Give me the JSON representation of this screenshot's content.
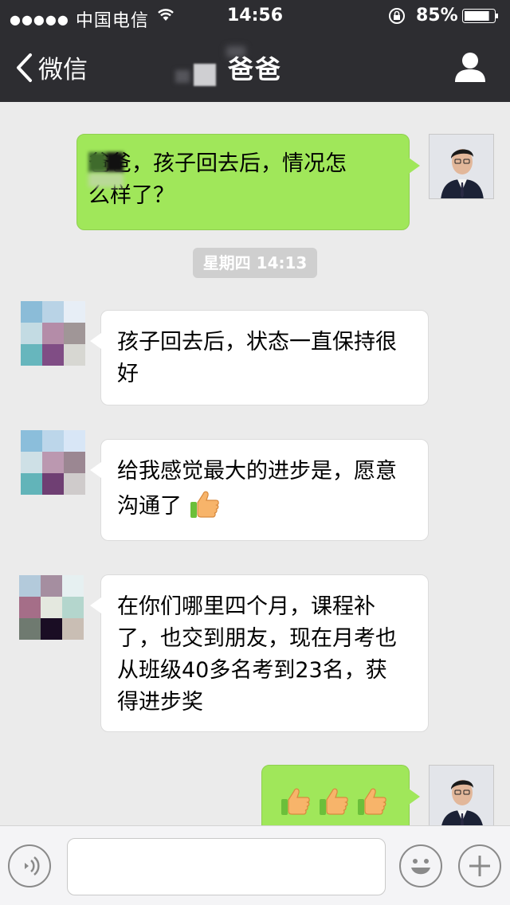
{
  "status_bar": {
    "carrier": "中国电信",
    "time": "14:56",
    "battery_percent": "85%",
    "battery_level": 0.85
  },
  "nav": {
    "back_label": "微信",
    "title": "爸爸"
  },
  "messages": [
    {
      "from": "me",
      "text_line1": "爸爸，孩子回去后，情况怎",
      "text_line2": "么样了？"
    },
    {
      "from": "them",
      "text_line1": "孩子回去后，状态一直保持很",
      "text_line2": "好"
    },
    {
      "from": "them",
      "text_line1": "给我感觉最大的进步是，愿意",
      "text_line2": "沟通了"
    },
    {
      "from": "them",
      "text_line1": "在你们哪里四个月，课程补",
      "text_line2": "了，也交到朋友，现在月考也",
      "text_line3": "从班级40多名考到23名，获",
      "text_line4": "得进步奖"
    },
    {
      "from": "me",
      "emoji": "thumbs-up x3"
    }
  ],
  "timestamp": "星期四 14:13",
  "icons": {
    "back": "chevron-left-icon",
    "profile": "person-icon",
    "voice": "voice-icon",
    "emoji": "smiley-icon",
    "plus": "plus-icon",
    "thumbs_up": "thumbs-up-icon"
  },
  "colors": {
    "nav_bg": "#2d2d31",
    "chat_bg": "#ebebeb",
    "my_bubble": "#a0e75a",
    "their_bubble": "#ffffff"
  },
  "input": {
    "value": "",
    "placeholder": ""
  }
}
